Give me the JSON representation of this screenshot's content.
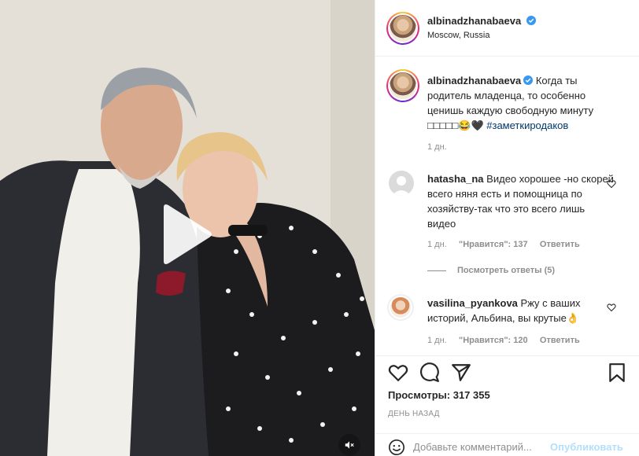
{
  "post": {
    "author": "albinadzhanabaeva",
    "location": "Moscow, Russia",
    "caption_text": "Когда ты родитель младенца, то особенно ценишь каждую свободную минуту",
    "caption_emoji": "□□□□□😂🖤",
    "caption_hashtag": "#заметкиродаков",
    "caption_age": "1 дн."
  },
  "comments": [
    {
      "username": "hatasha_na",
      "text": "Видео хорошее -но скорей всего няня есть и помощница по хозяйству-так что это всего лишь видео",
      "age": "1 дн.",
      "likes": "\"Нравится\": 137",
      "reply": "Ответить",
      "view_replies": "Посмотреть ответы (5)"
    },
    {
      "username": "vasilina_pyankova",
      "text": "Ржу с ваших историй, Альбина, вы крутые👌",
      "age": "1 дн.",
      "likes": "\"Нравится\": 120",
      "reply": "Ответить"
    }
  ],
  "stats": {
    "views_label": "Просмотры:",
    "views_value": "317 355",
    "timestamp": "ДЕНЬ НАЗАД"
  },
  "composer": {
    "placeholder": "Добавьте комментарий...",
    "publish_label": "Опубликовать"
  },
  "icons": {
    "like": "heart-icon",
    "comment": "comment-bubble-icon",
    "share": "paper-plane-icon",
    "save": "bookmark-icon",
    "play": "play-icon",
    "mute": "muted-speaker-icon",
    "emoji": "smiley-icon",
    "verified": "verified-badge-icon"
  },
  "colors": {
    "link": "#00376b",
    "muted": "#8e8e8e",
    "verified": "#3897f0",
    "publish_disabled": "#b2dffc"
  }
}
